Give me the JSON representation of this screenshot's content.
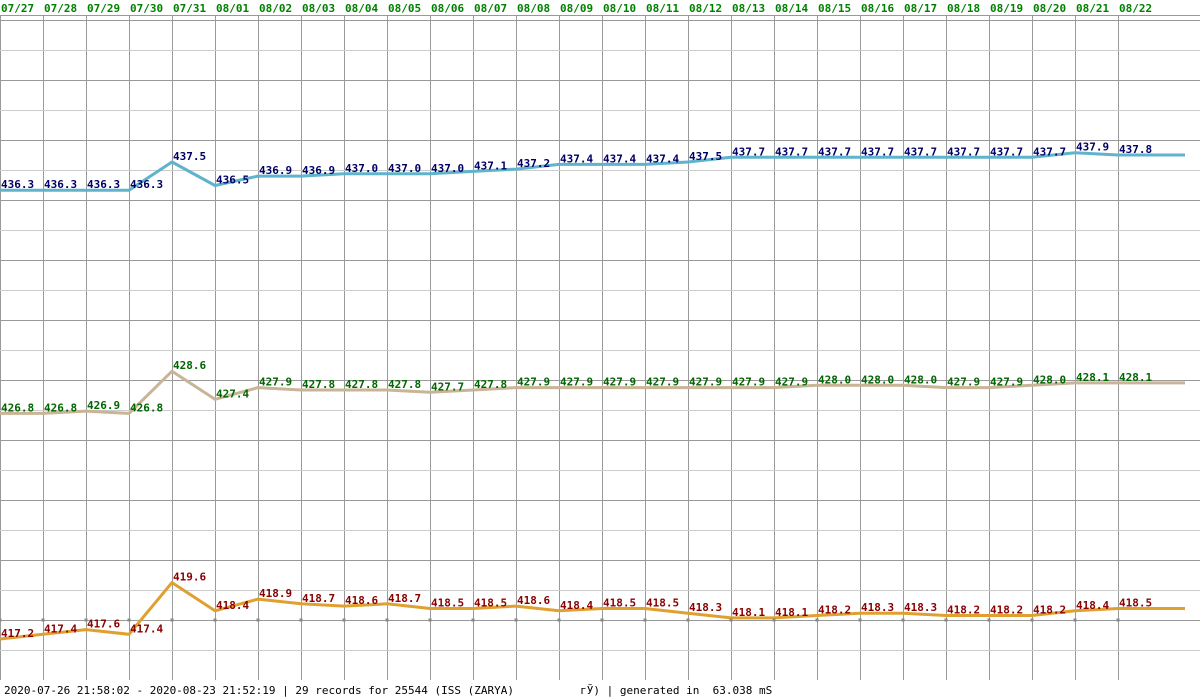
{
  "chart_data": {
    "type": "line",
    "title": "",
    "xlabel": "",
    "ylabel": "",
    "x": [
      "07/27",
      "07/28",
      "07/29",
      "07/30",
      "07/31",
      "08/01",
      "08/02",
      "08/03",
      "08/04",
      "08/05",
      "08/06",
      "08/07",
      "08/08",
      "08/09",
      "08/10",
      "08/11",
      "08/12",
      "08/13",
      "08/14",
      "08/15",
      "08/16",
      "08/17",
      "08/18",
      "08/19",
      "08/20",
      "08/21",
      "08/22"
    ],
    "ylim": [
      414,
      441
    ],
    "grid": true,
    "series": [
      {
        "color": "#5fb3cc",
        "label_color": "#000066",
        "values": [
          436.3,
          436.3,
          436.3,
          436.3,
          437.5,
          436.5,
          436.9,
          436.9,
          437.0,
          437.0,
          437.0,
          437.1,
          437.2,
          437.4,
          437.4,
          437.4,
          437.5,
          437.7,
          437.7,
          437.7,
          437.7,
          437.7,
          437.7,
          437.7,
          437.7,
          437.9,
          437.8
        ],
        "labels": [
          "436.3",
          "436.3",
          "436.3",
          "436.3",
          "437.5",
          "436.5",
          "436.9",
          "436.9",
          "437.0",
          "437.0",
          "437.0",
          "437.1",
          "437.2",
          "437.4",
          "437.4",
          "437.4",
          "437.5",
          "437.7",
          "437.7",
          "437.7",
          "437.7",
          "437.7",
          "437.7",
          "437.7",
          "437.7",
          "437.9",
          "437.8"
        ]
      },
      {
        "color": "#c8b496",
        "label_color": "#006600",
        "values": [
          426.8,
          426.8,
          426.9,
          426.8,
          428.6,
          427.4,
          427.9,
          427.8,
          427.8,
          427.8,
          427.7,
          427.8,
          427.9,
          427.9,
          427.9,
          427.9,
          427.9,
          427.9,
          427.9,
          428.0,
          428.0,
          428.0,
          427.9,
          427.9,
          428.0,
          428.1,
          428.1
        ],
        "labels": [
          "426.8",
          "426.8",
          "426.9",
          "426.8",
          "428.6",
          "427.4",
          "427.9",
          "427.8",
          "427.8",
          "427.8",
          "427.7",
          "427.8",
          "427.9",
          "427.9",
          "427.9",
          "427.9",
          "427.9",
          "427.9",
          "427.9",
          "428.0",
          "428.0",
          "428.0",
          "427.9",
          "427.9",
          "428.0",
          "428.1",
          "428.1"
        ]
      },
      {
        "color": "#e0a030",
        "label_color": "#880000",
        "values": [
          417.2,
          417.4,
          417.6,
          417.4,
          419.6,
          418.4,
          418.9,
          418.7,
          418.6,
          418.7,
          418.5,
          418.5,
          418.6,
          418.4,
          418.5,
          418.5,
          418.3,
          418.1,
          418.1,
          418.2,
          418.3,
          418.3,
          418.2,
          418.2,
          418.2,
          418.4,
          418.5
        ],
        "labels": [
          "417.2",
          "417.4",
          "417.6",
          "417.4",
          "419.6",
          "418.4",
          "418.9",
          "418.7",
          "418.6",
          "418.7",
          "418.5",
          "418.5",
          "418.6",
          "418.4",
          "418.5",
          "418.5",
          "418.3",
          "418.1",
          "418.1",
          "418.2",
          "418.3",
          "418.3",
          "418.2",
          "418.2",
          "418.2",
          "418.4",
          "418.5"
        ]
      }
    ]
  },
  "date_label_color": "#008000",
  "footer": {
    "text": "2020-07-26 21:58:02 - 2020-08-23 21:52:19 | 29 records for 25544 (ISS (ZARYA)          гЎ) | generated in  63.038 mS"
  }
}
